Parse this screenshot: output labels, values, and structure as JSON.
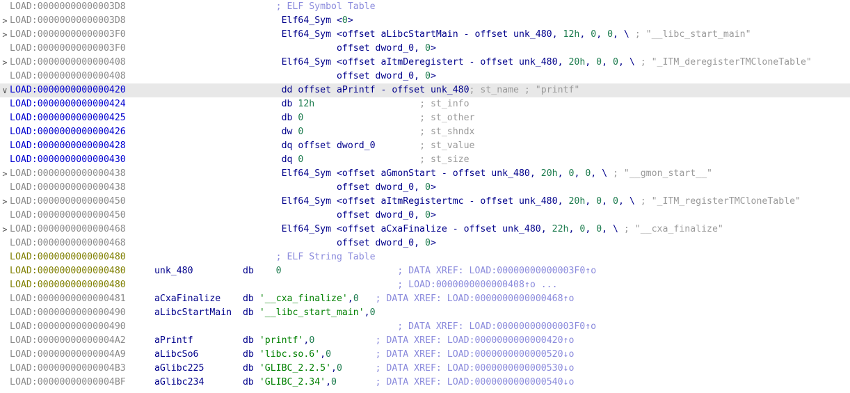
{
  "app": {
    "view": "ida-disassembly-listing",
    "segment": "LOAD"
  },
  "colors": {
    "background": "#ffffff",
    "selected_row": "#e8e8e8",
    "address_default": "#8a8a8a",
    "address_named": "#0000d0",
    "address_strtab": "#7f7f00",
    "keyword": "#00008b",
    "number": "#1a7a4c",
    "string": "#008000",
    "comment": "#9a9a9a",
    "xref": "#8a8adc"
  },
  "icons": {
    "collapsed": ">",
    "expanded": "∨",
    "xref_up": "↑o",
    "xref_down": "↓o"
  },
  "rows": [
    {
      "gutter": "",
      "addr": "LOAD:00000000000003D8",
      "addr_style": "default",
      "selected": false,
      "tokens": [
        {
          "t": "hdrcmt",
          "v": "                       ; ELF Symbol Table"
        }
      ]
    },
    {
      "gutter": ">",
      "addr": "LOAD:00000000000003D8",
      "addr_style": "default",
      "selected": false,
      "tokens": [
        {
          "t": "plain",
          "v": "                        "
        },
        {
          "t": "kw",
          "v": "Elf64_Sym <"
        },
        {
          "t": "num",
          "v": "0"
        },
        {
          "t": "kw",
          "v": ">"
        }
      ]
    },
    {
      "gutter": ">",
      "addr": "LOAD:00000000000003F0",
      "addr_style": "default",
      "selected": false,
      "tokens": [
        {
          "t": "plain",
          "v": "                        "
        },
        {
          "t": "kw",
          "v": "Elf64_Sym <offset "
        },
        {
          "t": "name",
          "v": "aLibcStartMain"
        },
        {
          "t": "kw",
          "v": " - offset "
        },
        {
          "t": "name",
          "v": "unk_480"
        },
        {
          "t": "kw",
          "v": ", "
        },
        {
          "t": "num",
          "v": "12h"
        },
        {
          "t": "kw",
          "v": ", "
        },
        {
          "t": "num",
          "v": "0"
        },
        {
          "t": "kw",
          "v": ", "
        },
        {
          "t": "num",
          "v": "0"
        },
        {
          "t": "kw",
          "v": ", \\ "
        },
        {
          "t": "cmt",
          "v": "; \"__libc_start_main\""
        }
      ]
    },
    {
      "gutter": "",
      "addr": "LOAD:00000000000003F0",
      "addr_style": "default",
      "selected": false,
      "tokens": [
        {
          "t": "plain",
          "v": "                                  "
        },
        {
          "t": "kw",
          "v": "offset "
        },
        {
          "t": "name",
          "v": "dword_0"
        },
        {
          "t": "kw",
          "v": ", "
        },
        {
          "t": "num",
          "v": "0"
        },
        {
          "t": "kw",
          "v": ">"
        }
      ]
    },
    {
      "gutter": ">",
      "addr": "LOAD:0000000000000408",
      "addr_style": "default",
      "selected": false,
      "tokens": [
        {
          "t": "plain",
          "v": "                        "
        },
        {
          "t": "kw",
          "v": "Elf64_Sym <offset "
        },
        {
          "t": "name",
          "v": "aItmDeregistert"
        },
        {
          "t": "kw",
          "v": " - offset "
        },
        {
          "t": "name",
          "v": "unk_480"
        },
        {
          "t": "kw",
          "v": ", "
        },
        {
          "t": "num",
          "v": "20h"
        },
        {
          "t": "kw",
          "v": ", "
        },
        {
          "t": "num",
          "v": "0"
        },
        {
          "t": "kw",
          "v": ", "
        },
        {
          "t": "num",
          "v": "0"
        },
        {
          "t": "kw",
          "v": ", \\ "
        },
        {
          "t": "cmt",
          "v": "; \"_ITM_deregisterTMCloneTable\""
        }
      ]
    },
    {
      "gutter": "",
      "addr": "LOAD:0000000000000408",
      "addr_style": "default",
      "selected": false,
      "tokens": [
        {
          "t": "plain",
          "v": "                                  "
        },
        {
          "t": "kw",
          "v": "offset "
        },
        {
          "t": "name",
          "v": "dword_0"
        },
        {
          "t": "kw",
          "v": ", "
        },
        {
          "t": "num",
          "v": "0"
        },
        {
          "t": "kw",
          "v": ">"
        }
      ]
    },
    {
      "gutter": "∨",
      "addr": "LOAD:0000000000000420",
      "addr_style": "named",
      "selected": true,
      "tokens": [
        {
          "t": "plain",
          "v": "                        "
        },
        {
          "t": "kw",
          "v": "dd offset "
        },
        {
          "t": "name",
          "v": "aPrintf"
        },
        {
          "t": "kw",
          "v": " - offset "
        },
        {
          "t": "name",
          "v": "unk_480"
        },
        {
          "t": "cmt",
          "v": "; st_name ; \"printf\""
        }
      ]
    },
    {
      "gutter": "",
      "addr": "LOAD:0000000000000424",
      "addr_style": "named",
      "selected": false,
      "tokens": [
        {
          "t": "plain",
          "v": "                        "
        },
        {
          "t": "kw",
          "v": "db "
        },
        {
          "t": "num",
          "v": "12h"
        },
        {
          "t": "plain",
          "v": "                   "
        },
        {
          "t": "cmt",
          "v": "; st_info"
        }
      ]
    },
    {
      "gutter": "",
      "addr": "LOAD:0000000000000425",
      "addr_style": "named",
      "selected": false,
      "tokens": [
        {
          "t": "plain",
          "v": "                        "
        },
        {
          "t": "kw",
          "v": "db "
        },
        {
          "t": "num",
          "v": "0"
        },
        {
          "t": "plain",
          "v": "                     "
        },
        {
          "t": "cmt",
          "v": "; st_other"
        }
      ]
    },
    {
      "gutter": "",
      "addr": "LOAD:0000000000000426",
      "addr_style": "named",
      "selected": false,
      "tokens": [
        {
          "t": "plain",
          "v": "                        "
        },
        {
          "t": "kw",
          "v": "dw "
        },
        {
          "t": "num",
          "v": "0"
        },
        {
          "t": "plain",
          "v": "                     "
        },
        {
          "t": "cmt",
          "v": "; st_shndx"
        }
      ]
    },
    {
      "gutter": "",
      "addr": "LOAD:0000000000000428",
      "addr_style": "named",
      "selected": false,
      "tokens": [
        {
          "t": "plain",
          "v": "                        "
        },
        {
          "t": "kw",
          "v": "dq offset "
        },
        {
          "t": "name",
          "v": "dword_0"
        },
        {
          "t": "plain",
          "v": "        "
        },
        {
          "t": "cmt",
          "v": "; st_value"
        }
      ]
    },
    {
      "gutter": "",
      "addr": "LOAD:0000000000000430",
      "addr_style": "named",
      "selected": false,
      "tokens": [
        {
          "t": "plain",
          "v": "                        "
        },
        {
          "t": "kw",
          "v": "dq "
        },
        {
          "t": "num",
          "v": "0"
        },
        {
          "t": "plain",
          "v": "                     "
        },
        {
          "t": "cmt",
          "v": "; st_size"
        }
      ]
    },
    {
      "gutter": ">",
      "addr": "LOAD:0000000000000438",
      "addr_style": "default",
      "selected": false,
      "tokens": [
        {
          "t": "plain",
          "v": "                        "
        },
        {
          "t": "kw",
          "v": "Elf64_Sym <offset "
        },
        {
          "t": "name",
          "v": "aGmonStart"
        },
        {
          "t": "kw",
          "v": " - offset "
        },
        {
          "t": "name",
          "v": "unk_480"
        },
        {
          "t": "kw",
          "v": ", "
        },
        {
          "t": "num",
          "v": "20h"
        },
        {
          "t": "kw",
          "v": ", "
        },
        {
          "t": "num",
          "v": "0"
        },
        {
          "t": "kw",
          "v": ", "
        },
        {
          "t": "num",
          "v": "0"
        },
        {
          "t": "kw",
          "v": ", \\ "
        },
        {
          "t": "cmt",
          "v": "; \"__gmon_start__\""
        }
      ]
    },
    {
      "gutter": "",
      "addr": "LOAD:0000000000000438",
      "addr_style": "default",
      "selected": false,
      "tokens": [
        {
          "t": "plain",
          "v": "                                  "
        },
        {
          "t": "kw",
          "v": "offset "
        },
        {
          "t": "name",
          "v": "dword_0"
        },
        {
          "t": "kw",
          "v": ", "
        },
        {
          "t": "num",
          "v": "0"
        },
        {
          "t": "kw",
          "v": ">"
        }
      ]
    },
    {
      "gutter": ">",
      "addr": "LOAD:0000000000000450",
      "addr_style": "default",
      "selected": false,
      "tokens": [
        {
          "t": "plain",
          "v": "                        "
        },
        {
          "t": "kw",
          "v": "Elf64_Sym <offset "
        },
        {
          "t": "name",
          "v": "aItmRegistertmc"
        },
        {
          "t": "kw",
          "v": " - offset "
        },
        {
          "t": "name",
          "v": "unk_480"
        },
        {
          "t": "kw",
          "v": ", "
        },
        {
          "t": "num",
          "v": "20h"
        },
        {
          "t": "kw",
          "v": ", "
        },
        {
          "t": "num",
          "v": "0"
        },
        {
          "t": "kw",
          "v": ", "
        },
        {
          "t": "num",
          "v": "0"
        },
        {
          "t": "kw",
          "v": ", \\ "
        },
        {
          "t": "cmt",
          "v": "; \"_ITM_registerTMCloneTable\""
        }
      ]
    },
    {
      "gutter": "",
      "addr": "LOAD:0000000000000450",
      "addr_style": "default",
      "selected": false,
      "tokens": [
        {
          "t": "plain",
          "v": "                                  "
        },
        {
          "t": "kw",
          "v": "offset "
        },
        {
          "t": "name",
          "v": "dword_0"
        },
        {
          "t": "kw",
          "v": ", "
        },
        {
          "t": "num",
          "v": "0"
        },
        {
          "t": "kw",
          "v": ">"
        }
      ]
    },
    {
      "gutter": ">",
      "addr": "LOAD:0000000000000468",
      "addr_style": "default",
      "selected": false,
      "tokens": [
        {
          "t": "plain",
          "v": "                        "
        },
        {
          "t": "kw",
          "v": "Elf64_Sym <offset "
        },
        {
          "t": "name",
          "v": "aCxaFinalize"
        },
        {
          "t": "kw",
          "v": " - offset "
        },
        {
          "t": "name",
          "v": "unk_480"
        },
        {
          "t": "kw",
          "v": ", "
        },
        {
          "t": "num",
          "v": "22h"
        },
        {
          "t": "kw",
          "v": ", "
        },
        {
          "t": "num",
          "v": "0"
        },
        {
          "t": "kw",
          "v": ", "
        },
        {
          "t": "num",
          "v": "0"
        },
        {
          "t": "kw",
          "v": ", \\ "
        },
        {
          "t": "cmt",
          "v": "; \"__cxa_finalize\""
        }
      ]
    },
    {
      "gutter": "",
      "addr": "LOAD:0000000000000468",
      "addr_style": "default",
      "selected": false,
      "tokens": [
        {
          "t": "plain",
          "v": "                                  "
        },
        {
          "t": "kw",
          "v": "offset "
        },
        {
          "t": "name",
          "v": "dword_0"
        },
        {
          "t": "kw",
          "v": ", "
        },
        {
          "t": "num",
          "v": "0"
        },
        {
          "t": "kw",
          "v": ">"
        }
      ]
    },
    {
      "gutter": "",
      "addr": "LOAD:0000000000000480",
      "addr_style": "strtab",
      "selected": false,
      "tokens": [
        {
          "t": "hdrcmt",
          "v": "                       ; ELF String Table"
        }
      ]
    },
    {
      "gutter": "",
      "addr": "LOAD:0000000000000480",
      "addr_style": "strtab",
      "selected": false,
      "tokens": [
        {
          "t": "name",
          "v": " unk_480"
        },
        {
          "t": "plain",
          "v": "         "
        },
        {
          "t": "kw",
          "v": "db "
        },
        {
          "t": "plain",
          "v": "   "
        },
        {
          "t": "num",
          "v": "0"
        },
        {
          "t": "plain",
          "v": "                     "
        },
        {
          "t": "xref",
          "v": "; DATA XREF: LOAD:00000000000003F0↑o"
        }
      ]
    },
    {
      "gutter": "",
      "addr": "LOAD:0000000000000480",
      "addr_style": "strtab",
      "selected": false,
      "tokens": [
        {
          "t": "plain",
          "v": "                                             "
        },
        {
          "t": "xref",
          "v": "; LOAD:0000000000000408↑o ..."
        }
      ]
    },
    {
      "gutter": "",
      "addr": "LOAD:0000000000000481",
      "addr_style": "default",
      "selected": false,
      "tokens": [
        {
          "t": "name",
          "v": " aCxaFinalize"
        },
        {
          "t": "plain",
          "v": "    "
        },
        {
          "t": "kw",
          "v": "db "
        },
        {
          "t": "str",
          "v": "'__cxa_finalize'"
        },
        {
          "t": "kw",
          "v": ","
        },
        {
          "t": "num",
          "v": "0"
        },
        {
          "t": "plain",
          "v": "   "
        },
        {
          "t": "xref",
          "v": "; DATA XREF: LOAD:0000000000000468↑o"
        }
      ]
    },
    {
      "gutter": "",
      "addr": "LOAD:0000000000000490",
      "addr_style": "default",
      "selected": false,
      "tokens": [
        {
          "t": "name",
          "v": " aLibcStartMain"
        },
        {
          "t": "plain",
          "v": "  "
        },
        {
          "t": "kw",
          "v": "db "
        },
        {
          "t": "str",
          "v": "'__libc_start_main'"
        },
        {
          "t": "kw",
          "v": ","
        },
        {
          "t": "num",
          "v": "0"
        }
      ]
    },
    {
      "gutter": "",
      "addr": "LOAD:0000000000000490",
      "addr_style": "default",
      "selected": false,
      "tokens": [
        {
          "t": "plain",
          "v": "                                             "
        },
        {
          "t": "xref",
          "v": "; DATA XREF: LOAD:00000000000003F0↑o"
        }
      ]
    },
    {
      "gutter": "",
      "addr": "LOAD:00000000000004A2",
      "addr_style": "default",
      "selected": false,
      "tokens": [
        {
          "t": "name",
          "v": " aPrintf"
        },
        {
          "t": "plain",
          "v": "         "
        },
        {
          "t": "kw",
          "v": "db "
        },
        {
          "t": "str",
          "v": "'printf'"
        },
        {
          "t": "kw",
          "v": ","
        },
        {
          "t": "num",
          "v": "0"
        },
        {
          "t": "plain",
          "v": "           "
        },
        {
          "t": "xref",
          "v": "; DATA XREF: LOAD:0000000000000420↑o"
        }
      ]
    },
    {
      "gutter": "",
      "addr": "LOAD:00000000000004A9",
      "addr_style": "default",
      "selected": false,
      "tokens": [
        {
          "t": "name",
          "v": " aLibcSo6"
        },
        {
          "t": "plain",
          "v": "        "
        },
        {
          "t": "kw",
          "v": "db "
        },
        {
          "t": "str",
          "v": "'libc.so.6'"
        },
        {
          "t": "kw",
          "v": ","
        },
        {
          "t": "num",
          "v": "0"
        },
        {
          "t": "plain",
          "v": "        "
        },
        {
          "t": "xref",
          "v": "; DATA XREF: LOAD:0000000000000520↓o"
        }
      ]
    },
    {
      "gutter": "",
      "addr": "LOAD:00000000000004B3",
      "addr_style": "default",
      "selected": false,
      "tokens": [
        {
          "t": "name",
          "v": " aGlibc225"
        },
        {
          "t": "plain",
          "v": "       "
        },
        {
          "t": "kw",
          "v": "db "
        },
        {
          "t": "str",
          "v": "'GLIBC_2.2.5'"
        },
        {
          "t": "kw",
          "v": ","
        },
        {
          "t": "num",
          "v": "0"
        },
        {
          "t": "plain",
          "v": "      "
        },
        {
          "t": "xref",
          "v": "; DATA XREF: LOAD:0000000000000530↓o"
        }
      ]
    },
    {
      "gutter": "",
      "addr": "LOAD:00000000000004BF",
      "addr_style": "default",
      "selected": false,
      "tokens": [
        {
          "t": "name",
          "v": " aGlibc234"
        },
        {
          "t": "plain",
          "v": "       "
        },
        {
          "t": "kw",
          "v": "db "
        },
        {
          "t": "str",
          "v": "'GLIBC_2.34'"
        },
        {
          "t": "kw",
          "v": ","
        },
        {
          "t": "num",
          "v": "0"
        },
        {
          "t": "plain",
          "v": "       "
        },
        {
          "t": "xref",
          "v": "; DATA XREF: LOAD:0000000000000540↓o"
        }
      ]
    }
  ]
}
